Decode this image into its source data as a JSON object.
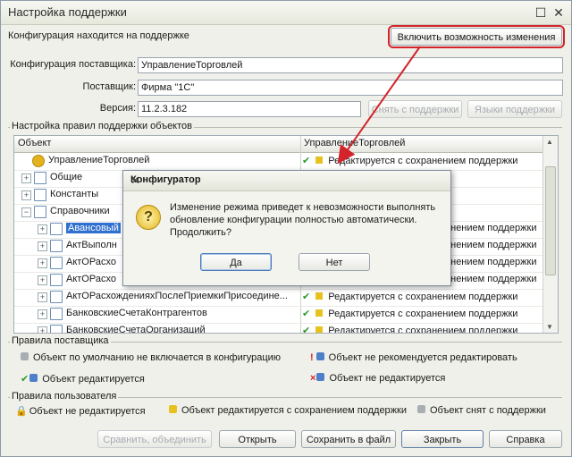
{
  "window": {
    "title": "Настройка поддержки",
    "minimize_glyph": "☐",
    "close_glyph": "✕"
  },
  "support_status": "Конфигурация находится на поддержке",
  "enable_change_button": "Включить возможность изменения",
  "vendor": {
    "config_label": "Конфигурация поставщика:",
    "config_value": "УправлениеТорговлей",
    "supplier_label": "Поставщик:",
    "supplier_value": "Фирма \"1С\"",
    "version_label": "Версия:",
    "version_value": "11.2.3.182"
  },
  "remove_support_button": "Снять с поддержки",
  "languages_button": "Языки поддержки",
  "rules_group_title": "Настройка правил поддержки объектов",
  "tree": {
    "columns": [
      "Объект",
      "УправлениеТорговлей"
    ],
    "rows": [
      {
        "name": "УправлениеТорговлей",
        "rule": "Редактируется с сохранением поддержки",
        "level": 0,
        "expander": ""
      },
      {
        "name": "Общие",
        "rule": "",
        "level": 1,
        "expander": "+"
      },
      {
        "name": "Константы",
        "rule": "",
        "level": 1,
        "expander": "+"
      },
      {
        "name": "Справочники",
        "rule": "",
        "level": 1,
        "expander": "−"
      },
      {
        "name": "Авансовый",
        "rule": "енением поддержки",
        "level": 2,
        "expander": "+",
        "selected": true
      },
      {
        "name": "АктВыполн",
        "rule": "енением поддержки",
        "level": 2,
        "expander": "+"
      },
      {
        "name": "АктОРасхо",
        "rule": "енением поддержки",
        "level": 2,
        "expander": "+"
      },
      {
        "name": "АктОРасхо",
        "rule": "енением поддержки",
        "level": 2,
        "expander": "+"
      },
      {
        "name": "АктОРасхожденияхПослеПриемкиПрисоедине...",
        "rule": "Редактируется с сохранением поддержки",
        "level": 2,
        "expander": "+"
      },
      {
        "name": "БанковскиеСчетаКонтрагентов",
        "rule": "Редактируется с сохранением поддержки",
        "level": 2,
        "expander": "+"
      },
      {
        "name": "БанковскиеСчетаОрганизаций",
        "rule": "Редактируется с сохранением поддержки",
        "level": 2,
        "expander": "+"
      }
    ]
  },
  "vendor_rules": {
    "title": "Правила поставщика",
    "items": [
      "Объект по умолчанию не включается в конфигурацию",
      "Объект не рекомендуется редактировать",
      "Объект редактируется",
      "Объект не редактируется"
    ]
  },
  "user_rules": {
    "title": "Правила пользователя",
    "items": [
      "Объект не редактируется",
      "Объект редактируется с сохранением поддержки",
      "Объект снят с поддержки"
    ]
  },
  "footer": {
    "compare": "Сравнить, объединить",
    "open": "Открыть",
    "save": "Сохранить в файл",
    "close": "Закрыть",
    "help": "Справка"
  },
  "dialog": {
    "title": "Конфигуратор",
    "message": "Изменение режима приведет к невозможности выполнять обновление конфигурации полностью автоматически. Продолжить?",
    "yes": "Да",
    "no": "Нет",
    "icon_glyph": "?"
  },
  "colors": {
    "highlight_red": "#d2242a",
    "selection_blue": "#2f6fd0"
  }
}
